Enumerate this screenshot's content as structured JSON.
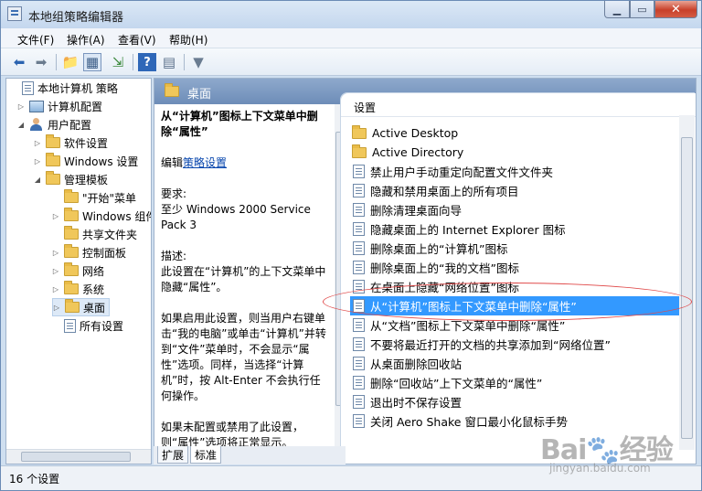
{
  "window": {
    "title": "本地组策略编辑器"
  },
  "menubar": [
    "文件(F)",
    "操作(A)",
    "查看(V)",
    "帮助(H)"
  ],
  "toolbar": {
    "icons": [
      "back-icon",
      "forward-icon",
      "up-folder-icon",
      "show-hide-tree-icon",
      "export-list-icon",
      "help-icon",
      "properties-icon",
      "filter-icon"
    ]
  },
  "tree": {
    "nodes": [
      {
        "label": "本地计算机 策略",
        "icon": "policy-icon"
      },
      {
        "label": "计算机配置",
        "icon": "computer-icon"
      },
      {
        "label": "用户配置",
        "icon": "user-icon"
      },
      {
        "label": "软件设置",
        "icon": "folder-icon"
      },
      {
        "label": "Windows 设置",
        "icon": "folder-icon"
      },
      {
        "label": "管理模板",
        "icon": "folder-icon"
      },
      {
        "label": "\"开始\"菜单",
        "icon": "folder-icon"
      },
      {
        "label": "Windows 组件",
        "icon": "folder-icon"
      },
      {
        "label": "共享文件夹",
        "icon": "folder-icon"
      },
      {
        "label": "控制面板",
        "icon": "folder-icon"
      },
      {
        "label": "网络",
        "icon": "folder-icon"
      },
      {
        "label": "系统",
        "icon": "folder-icon"
      },
      {
        "label": "桌面",
        "icon": "folder-icon"
      },
      {
        "label": "所有设置",
        "icon": "settings-icon"
      }
    ]
  },
  "content": {
    "header": "桌面",
    "description": {
      "title": "从“计算机”图标上下文菜单中删除“属性”",
      "edit_prefix": "编辑",
      "edit_link": "策略设置",
      "requirement_label": "要求:",
      "requirement": "至少 Windows 2000 Service Pack 3",
      "desc_label": "描述:",
      "desc": "此设置在“计算机”的上下文菜单中隐藏“属性”。",
      "detail1": "如果启用此设置，则当用户右键单击“我的电脑”或单击“计算机”并转到“文件”菜单时，不会显示“属性”选项。同样，当选择“计算机”时，按 Alt-Enter 不会执行任何操作。",
      "detail2": "如果未配置或禁用了此设置，则“属性”选项将正常显示。"
    },
    "list_header": "设置",
    "list_items": [
      {
        "label": "Active Desktop",
        "icon": "folder-icon"
      },
      {
        "label": "Active Directory",
        "icon": "folder-icon"
      },
      {
        "label": "禁止用户手动重定向配置文件文件夹",
        "icon": "setting-icon"
      },
      {
        "label": "隐藏和禁用桌面上的所有项目",
        "icon": "setting-icon"
      },
      {
        "label": "删除清理桌面向导",
        "icon": "setting-icon"
      },
      {
        "label": "隐藏桌面上的 Internet Explorer 图标",
        "icon": "setting-icon"
      },
      {
        "label": "删除桌面上的“计算机”图标",
        "icon": "setting-icon"
      },
      {
        "label": "删除桌面上的“我的文档”图标",
        "icon": "setting-icon"
      },
      {
        "label": "在桌面上隐藏“网络位置”图标",
        "icon": "setting-icon"
      },
      {
        "label": "从“计算机”图标上下文菜单中删除“属性”",
        "icon": "setting-icon",
        "selected": true
      },
      {
        "label": "从“文档”图标上下文菜单中删除“属性”",
        "icon": "setting-icon"
      },
      {
        "label": "不要将最近打开的文档的共享添加到“网络位置”",
        "icon": "setting-icon"
      },
      {
        "label": "从桌面删除回收站",
        "icon": "setting-icon"
      },
      {
        "label": "删除“回收站”上下文菜单的“属性”",
        "icon": "setting-icon"
      },
      {
        "label": "退出时不保存设置",
        "icon": "setting-icon"
      },
      {
        "label": "关闭 Aero Shake 窗口最小化鼠标手势",
        "icon": "setting-icon"
      }
    ],
    "tabs": [
      "扩展",
      "标准"
    ]
  },
  "status": {
    "text": "16 个设置"
  },
  "watermark": {
    "main": "Bai🐾经验",
    "sub": "jingyan.baidu.com"
  },
  "colors": {
    "selection": "#3399ff",
    "header": "#7b98c2",
    "highlight_oval": "#e04a4a"
  }
}
